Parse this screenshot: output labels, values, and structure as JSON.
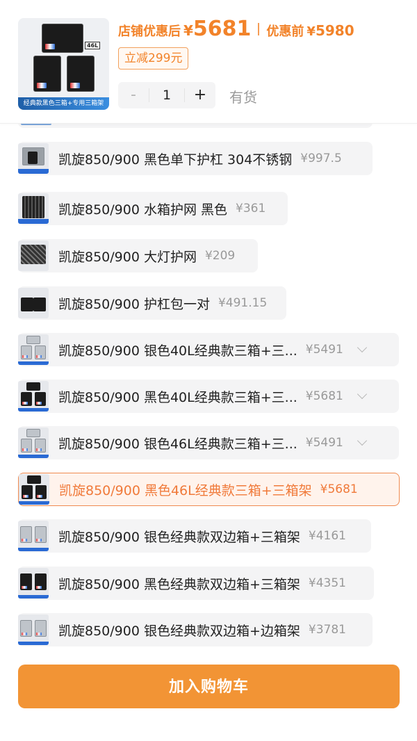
{
  "product": {
    "image_banner": "经典款黑色三箱+专用三箱架",
    "image_tag": "46L",
    "promo_price_label": "店铺优惠后",
    "currency": "¥",
    "promo_price": "5681",
    "original_price_label": "优惠前",
    "original_price": "5980",
    "discount_label": "立减299元"
  },
  "quantity": {
    "minus": "-",
    "value": "1",
    "plus": "+"
  },
  "stock_status": "有货",
  "options": [
    {
      "name": "凯旋850/900 黑色单下护杠 304不锈钢",
      "price": "¥997.5",
      "has_chevron": false,
      "selected": false,
      "thumb": "guard"
    },
    {
      "name": "凯旋850/900 水箱护网 黑色",
      "price": "¥361",
      "has_chevron": false,
      "selected": false,
      "thumb": "grille"
    },
    {
      "name": "凯旋850/900 大灯护网",
      "price": "¥209",
      "has_chevron": false,
      "selected": false,
      "thumb": "lamp"
    },
    {
      "name": "凯旋850/900 护杠包一对",
      "price": "¥491.15",
      "has_chevron": false,
      "selected": false,
      "thumb": "bag"
    },
    {
      "name": "凯旋850/900 银色40L经典款三箱+三...",
      "price": "¥5491",
      "has_chevron": true,
      "selected": false,
      "thumb": "silver3"
    },
    {
      "name": "凯旋850/900 黑色40L经典款三箱+三...",
      "price": "¥5681",
      "has_chevron": true,
      "selected": false,
      "thumb": "black3"
    },
    {
      "name": "凯旋850/900 银色46L经典款三箱+三...",
      "price": "¥5491",
      "has_chevron": true,
      "selected": false,
      "thumb": "silver3"
    },
    {
      "name": "凯旋850/900 黑色46L经典款三箱+三箱架",
      "price": "¥5681",
      "has_chevron": false,
      "selected": true,
      "thumb": "black3"
    },
    {
      "name": "凯旋850/900 银色经典款双边箱+三箱架",
      "price": "¥4161",
      "has_chevron": false,
      "selected": false,
      "thumb": "silver2"
    },
    {
      "name": "凯旋850/900 黑色经典款双边箱+三箱架",
      "price": "¥4351",
      "has_chevron": false,
      "selected": false,
      "thumb": "black2"
    },
    {
      "name": "凯旋850/900 银色经典款双边箱+边箱架",
      "price": "¥3781",
      "has_chevron": false,
      "selected": false,
      "thumb": "silver2"
    }
  ],
  "add_to_cart_label": "加入购物车",
  "colors": {
    "accent_orange": "#f2832a",
    "cart_button": "#f29435",
    "selected_border": "#f08a50",
    "option_bg": "#f4f4f5",
    "muted_text": "#999999"
  }
}
